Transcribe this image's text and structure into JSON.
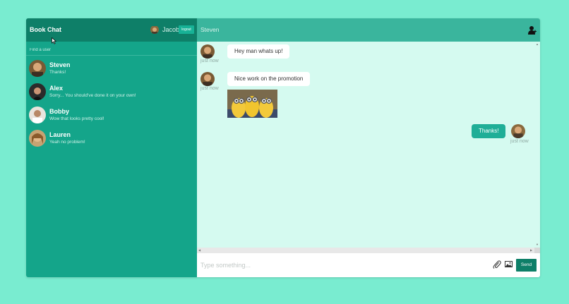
{
  "app": {
    "brand": "Book Chat"
  },
  "current_user": {
    "name": "Jacob",
    "logout_label": "logout"
  },
  "sidebar": {
    "search_placeholder": "Find a user",
    "contacts": [
      {
        "name": "Steven",
        "preview": "Thanks!"
      },
      {
        "name": "Alex",
        "preview": "Sorry... You should've done it on your own!"
      },
      {
        "name": "Bobby",
        "preview": "Wow that looks pretty cool!"
      },
      {
        "name": "Lauren",
        "preview": "Yeah no problem!"
      }
    ]
  },
  "chat": {
    "title": "Steven",
    "messages": [
      {
        "text": "Hey man whats up!",
        "time": "just now"
      },
      {
        "text": "Nice work on the promotion",
        "time": "just now"
      },
      {
        "text": "Thanks!",
        "time": "just now"
      }
    ],
    "composer": {
      "placeholder": "Type something...",
      "send_label": "Send"
    }
  },
  "colors": {
    "page_background": "#79ecd0",
    "sidebar": "#14a58a",
    "sidebar_header": "#0e7f68",
    "chat_header": "#3ab59d",
    "chat_background": "#d5faf0",
    "sent_bubble": "#1fae97"
  },
  "icons": {
    "user": "user-add-icon",
    "attach": "paperclip-icon",
    "image": "image-icon"
  }
}
